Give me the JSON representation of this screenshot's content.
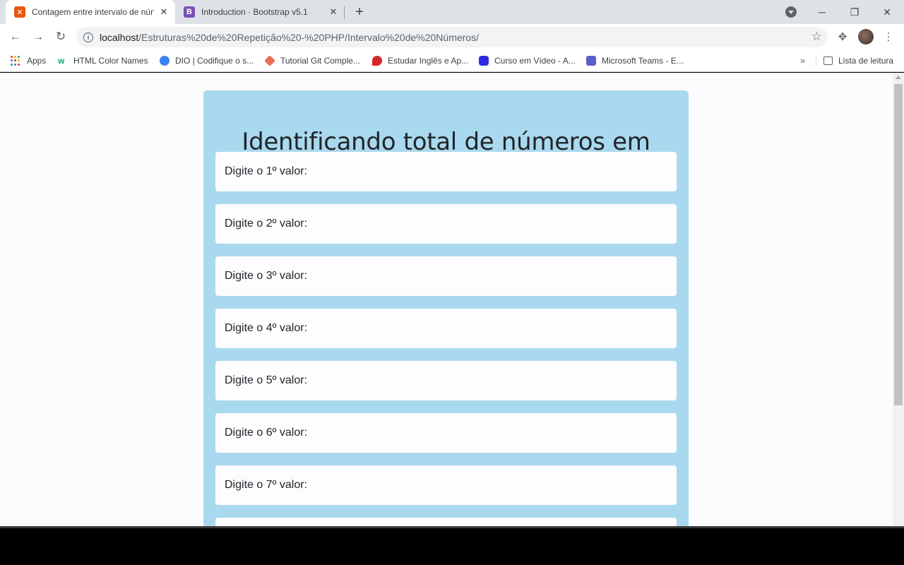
{
  "browser": {
    "tabs": [
      {
        "title": "Contagem entre intervalo de nún",
        "active": true,
        "favicon_color": "#e8590c"
      },
      {
        "title": "Introduction · Bootstrap v5.1",
        "active": false,
        "favicon_color": "#7952b3",
        "favicon_letter": "B"
      }
    ],
    "url_host": "localhost",
    "url_path": "/Estruturas%20de%20Repetição%20-%20PHP/Intervalo%20de%20Números/",
    "bookmarks": [
      {
        "label": "Apps",
        "icon": "apps-grid-icon"
      },
      {
        "label": "HTML Color Names",
        "icon": "w3-icon",
        "color": "#04aa6d"
      },
      {
        "label": "DIO | Codifique o s...",
        "icon": "dio-icon",
        "color": "#3b82f6"
      },
      {
        "label": "Tutorial Git Comple...",
        "icon": "git-icon",
        "color": "#e76f51"
      },
      {
        "label": "Estudar Inglês e Ap...",
        "icon": "english-icon",
        "color": "#d62828"
      },
      {
        "label": "Curso em Vídeo - A...",
        "icon": "cursoemvideo-icon",
        "color": "#2c2ce0"
      },
      {
        "label": "Microsoft Teams - E...",
        "icon": "teams-icon",
        "color": "#5b5fc7"
      }
    ],
    "reading_list": "Lista de leitura"
  },
  "page": {
    "heading": "Identificando total de números em intervalos",
    "fields": [
      {
        "label": "Digite o 1º valor:"
      },
      {
        "label": "Digite o 2º valor:"
      },
      {
        "label": "Digite o 3º valor:"
      },
      {
        "label": "Digite o 4º valor:"
      },
      {
        "label": "Digite o 5º valor:"
      },
      {
        "label": "Digite o 6º valor:"
      },
      {
        "label": "Digite o 7º valor:"
      },
      {
        "label": ""
      }
    ],
    "colors": {
      "card": "#a9d9ee",
      "background": "#fcfbfd"
    }
  }
}
